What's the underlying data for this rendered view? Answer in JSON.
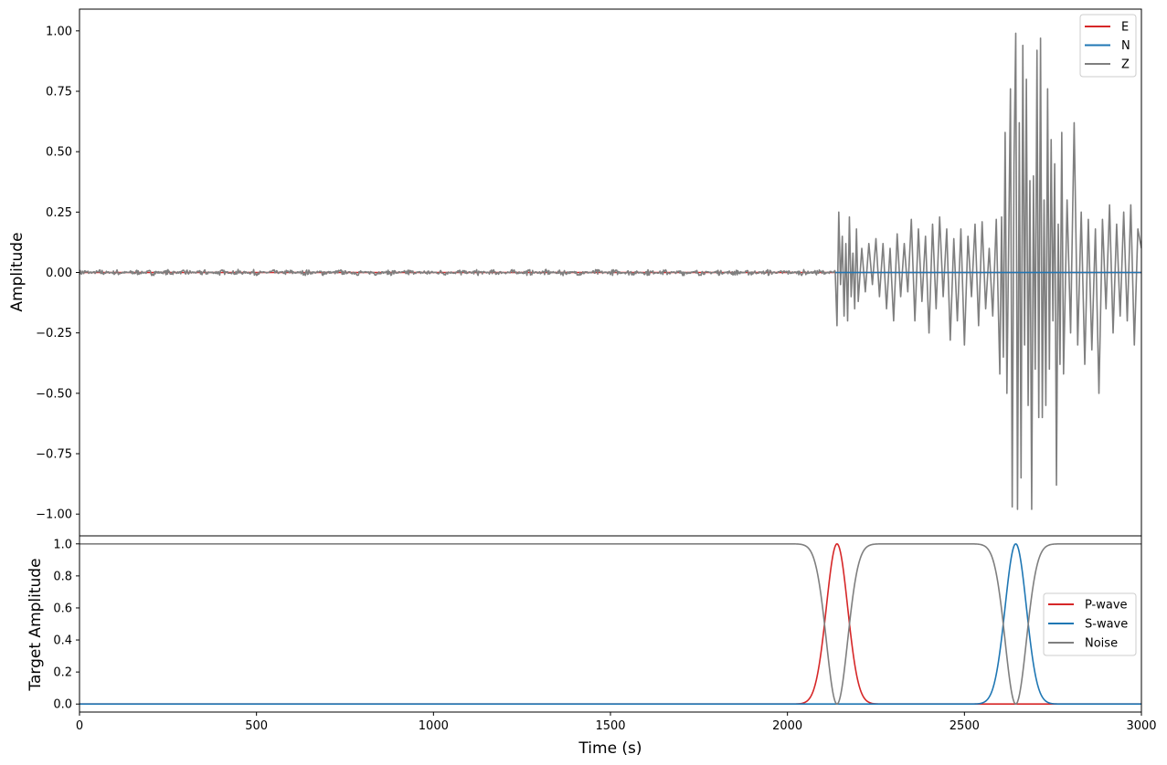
{
  "chart_data": [
    {
      "type": "line",
      "title": "",
      "xlabel": "",
      "ylabel": "Amplitude",
      "xlim": [
        0,
        3000
      ],
      "ylim": [
        -1.09,
        1.09
      ],
      "yticks": [
        -1.0,
        -0.75,
        -0.5,
        -0.25,
        0.0,
        0.25,
        0.5,
        0.75,
        1.0
      ],
      "ytick_labels": [
        "−1.00",
        "−0.75",
        "−0.50",
        "−0.25",
        "0.00",
        "0.25",
        "0.50",
        "0.75",
        "1.00"
      ],
      "grid": false,
      "legend": "top-right",
      "series": [
        {
          "name": "E",
          "color": "#d62728",
          "x": [
            0,
            3000
          ],
          "values": [
            0.0,
            0.0
          ]
        },
        {
          "name": "N",
          "color": "#1f77b4",
          "x": [
            2135,
            3000
          ],
          "values": [
            0.0,
            0.0
          ]
        },
        {
          "name": "Z",
          "color": "#7f7f7f",
          "noise_level": 0.008,
          "x": [
            2135,
            2140,
            2145,
            2150,
            2155,
            2160,
            2165,
            2170,
            2175,
            2180,
            2185,
            2190,
            2195,
            2200,
            2210,
            2220,
            2230,
            2240,
            2250,
            2260,
            2270,
            2280,
            2290,
            2300,
            2310,
            2320,
            2330,
            2340,
            2350,
            2360,
            2370,
            2380,
            2390,
            2400,
            2410,
            2420,
            2430,
            2440,
            2450,
            2460,
            2470,
            2480,
            2490,
            2500,
            2510,
            2520,
            2530,
            2540,
            2550,
            2560,
            2570,
            2580,
            2590,
            2600,
            2605,
            2610,
            2615,
            2620,
            2625,
            2630,
            2635,
            2640,
            2645,
            2650,
            2655,
            2660,
            2665,
            2670,
            2675,
            2680,
            2685,
            2690,
            2695,
            2700,
            2705,
            2710,
            2715,
            2720,
            2725,
            2730,
            2735,
            2740,
            2745,
            2750,
            2755,
            2760,
            2765,
            2770,
            2775,
            2780,
            2790,
            2800,
            2810,
            2820,
            2830,
            2840,
            2850,
            2860,
            2870,
            2880,
            2890,
            2900,
            2910,
            2920,
            2930,
            2940,
            2950,
            2960,
            2970,
            2980,
            2990,
            3000
          ],
          "values": [
            0.0,
            -0.22,
            0.25,
            -0.05,
            0.15,
            -0.18,
            0.12,
            -0.2,
            0.23,
            -0.1,
            0.08,
            -0.15,
            0.18,
            -0.12,
            0.1,
            -0.08,
            0.12,
            -0.05,
            0.14,
            -0.1,
            0.12,
            -0.15,
            0.1,
            -0.2,
            0.16,
            -0.1,
            0.12,
            -0.08,
            0.22,
            -0.2,
            0.18,
            -0.12,
            0.15,
            -0.25,
            0.2,
            -0.15,
            0.23,
            -0.1,
            0.18,
            -0.28,
            0.14,
            -0.2,
            0.18,
            -0.3,
            0.15,
            -0.1,
            0.2,
            -0.22,
            0.21,
            -0.15,
            0.1,
            -0.18,
            0.22,
            -0.42,
            0.23,
            -0.35,
            0.58,
            -0.5,
            0.12,
            0.76,
            -0.97,
            0.45,
            0.99,
            -0.98,
            0.62,
            -0.85,
            0.94,
            -0.3,
            0.8,
            -0.55,
            0.38,
            -0.98,
            0.4,
            -0.4,
            0.92,
            -0.6,
            0.97,
            -0.6,
            0.3,
            -0.55,
            0.76,
            -0.4,
            0.55,
            -0.2,
            0.45,
            -0.88,
            0.2,
            -0.38,
            0.58,
            -0.42,
            0.3,
            -0.25,
            0.62,
            -0.3,
            0.25,
            -0.38,
            0.22,
            -0.32,
            0.18,
            -0.5,
            0.22,
            -0.15,
            0.28,
            -0.25,
            0.2,
            -0.18,
            0.25,
            -0.2,
            0.28,
            -0.3,
            0.18,
            0.1
          ]
        }
      ]
    },
    {
      "type": "line",
      "title": "",
      "xlabel": "Time (s)",
      "ylabel": "Target Amplitude",
      "xlim": [
        0,
        3000
      ],
      "ylim": [
        -0.05,
        1.05
      ],
      "xticks": [
        0,
        500,
        1000,
        1500,
        2000,
        2500,
        3000
      ],
      "xtick_labels": [
        "0",
        "500",
        "1000",
        "1500",
        "2000",
        "2500",
        "3000"
      ],
      "yticks": [
        0.0,
        0.2,
        0.4,
        0.6,
        0.8,
        1.0
      ],
      "ytick_labels": [
        "0.0",
        "0.2",
        "0.4",
        "0.6",
        "0.8",
        "1.0"
      ],
      "grid": false,
      "legend": "center-right",
      "series": [
        {
          "name": "P-wave",
          "color": "#d62728",
          "center": 2140,
          "width": 30
        },
        {
          "name": "S-wave",
          "color": "#1f77b4",
          "center": 2645,
          "width": 30
        },
        {
          "name": "Noise",
          "color": "#7f7f7f"
        }
      ]
    }
  ]
}
